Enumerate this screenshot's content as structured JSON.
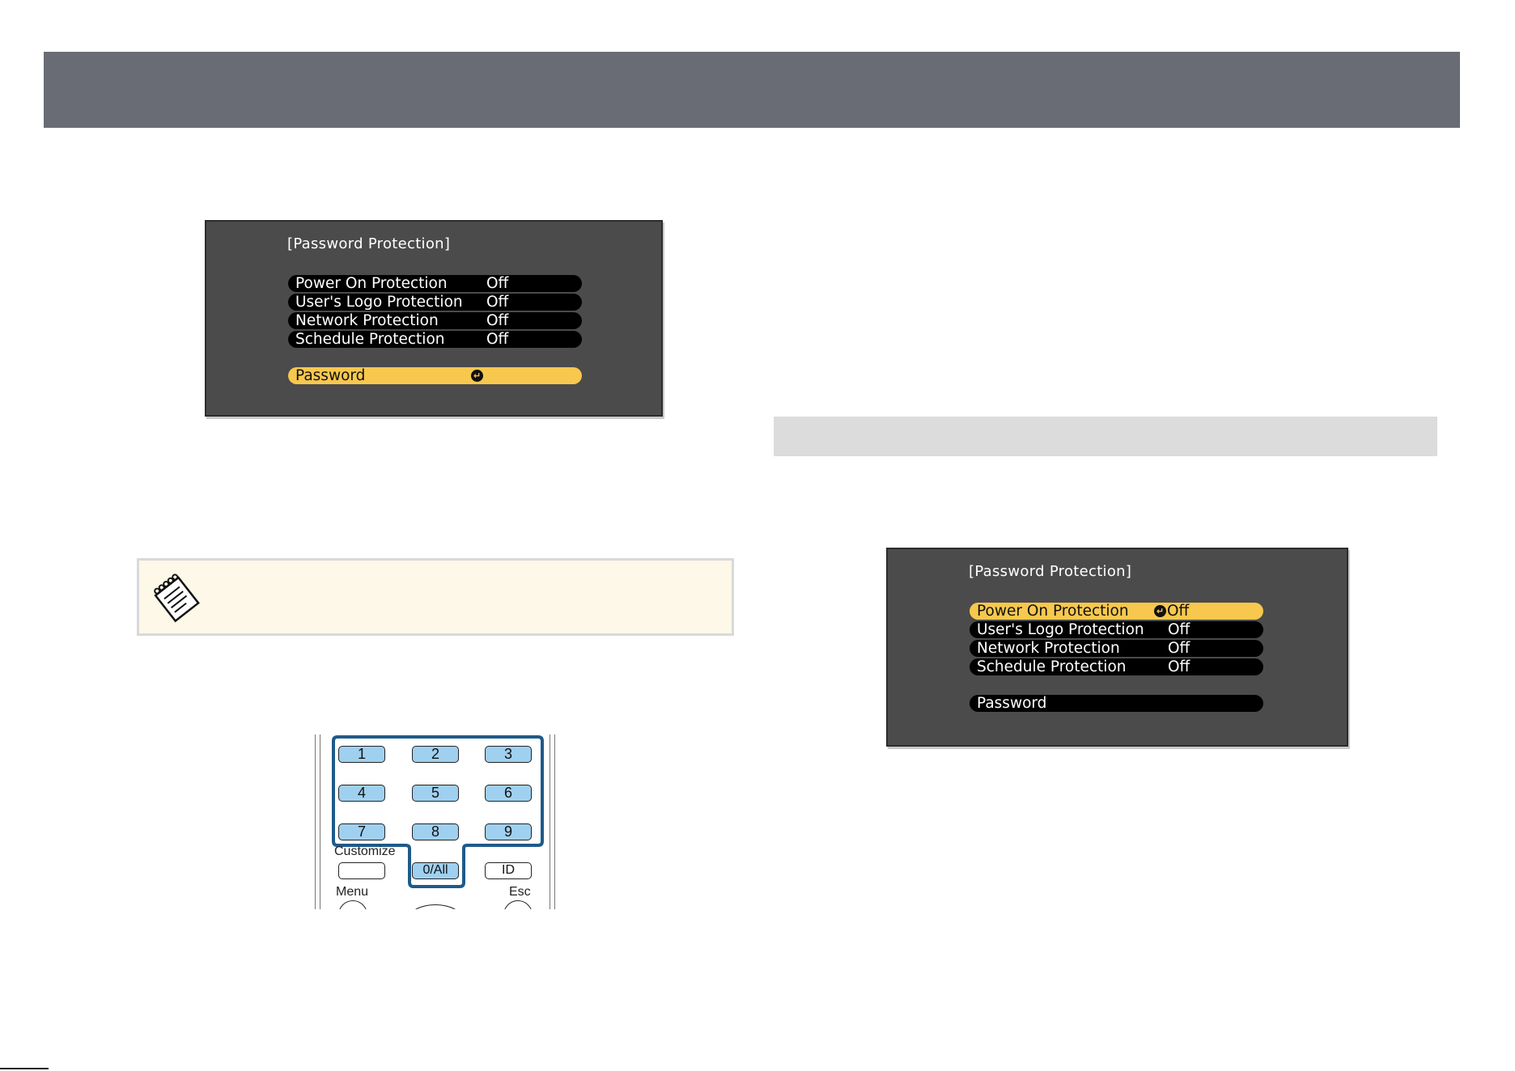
{
  "osd_top": {
    "title": "[Password Protection]",
    "rows": [
      {
        "label": "Power On Protection",
        "value": "Off"
      },
      {
        "label": "User's Logo Protection",
        "value": "Off"
      },
      {
        "label": "Network Protection",
        "value": "Off"
      },
      {
        "label": "Schedule Protection",
        "value": "Off"
      }
    ],
    "password_label": "Password",
    "enter_glyph": "↵"
  },
  "osd_bottom": {
    "title": "[Password Protection]",
    "rows": [
      {
        "label": "Power On Protection",
        "value": "Off"
      },
      {
        "label": "User's Logo Protection",
        "value": "Off"
      },
      {
        "label": "Network Protection",
        "value": "Off"
      },
      {
        "label": "Schedule Protection",
        "value": "Off"
      }
    ],
    "password_label": "Password",
    "enter_glyph": "↵"
  },
  "note": {
    "icon": "note-pad-icon"
  },
  "remote": {
    "keys": [
      "1",
      "2",
      "3",
      "4",
      "5",
      "6",
      "7",
      "8",
      "9"
    ],
    "customize_label": "Customize",
    "zero_key": "0/All",
    "id_key": "ID",
    "menu_label": "Menu",
    "esc_label": "Esc",
    "highlight_color": "#1f5a8a"
  },
  "colors": {
    "header": "#6a6c75",
    "osd_bg": "#4b4b4b",
    "selected_row": "#f7c84d",
    "note_bg": "#fdf8e8",
    "key_fill": "#9fd0f0"
  }
}
